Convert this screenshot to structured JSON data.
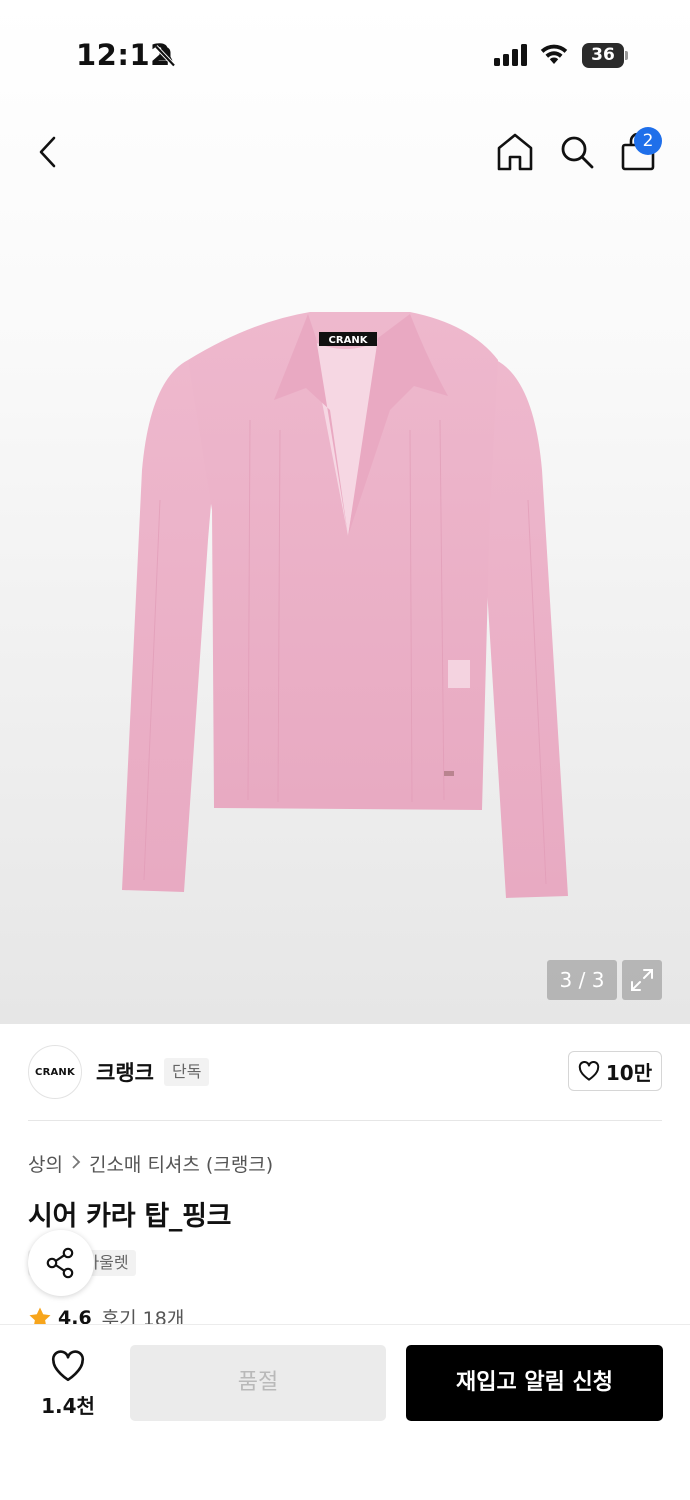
{
  "status_bar": {
    "time": "12:12",
    "battery": "36"
  },
  "nav": {
    "cart_count": "2"
  },
  "gallery": {
    "counter": "3 / 3",
    "label_text": "CRANK"
  },
  "brand": {
    "logo_text": "CRANK",
    "name": "크랭크",
    "tag": "단독",
    "likes": "10만"
  },
  "breadcrumb": {
    "category": "상의",
    "sub_category": "긴소매 티셔츠 (크랭크)"
  },
  "product": {
    "title": "시어 카라 탑_핑크",
    "tags": [
      "단독",
      "아울렛"
    ],
    "rating": "4.6",
    "reviews": "후기 18개"
  },
  "bottom_bar": {
    "like_count": "1.4천",
    "soldout_label": "품절",
    "restock_label": "재입고 알림 신청"
  },
  "colors": {
    "accent_blue": "#1f6fea",
    "product_pink": "#ebb2c9",
    "star": "#f7a51c"
  }
}
